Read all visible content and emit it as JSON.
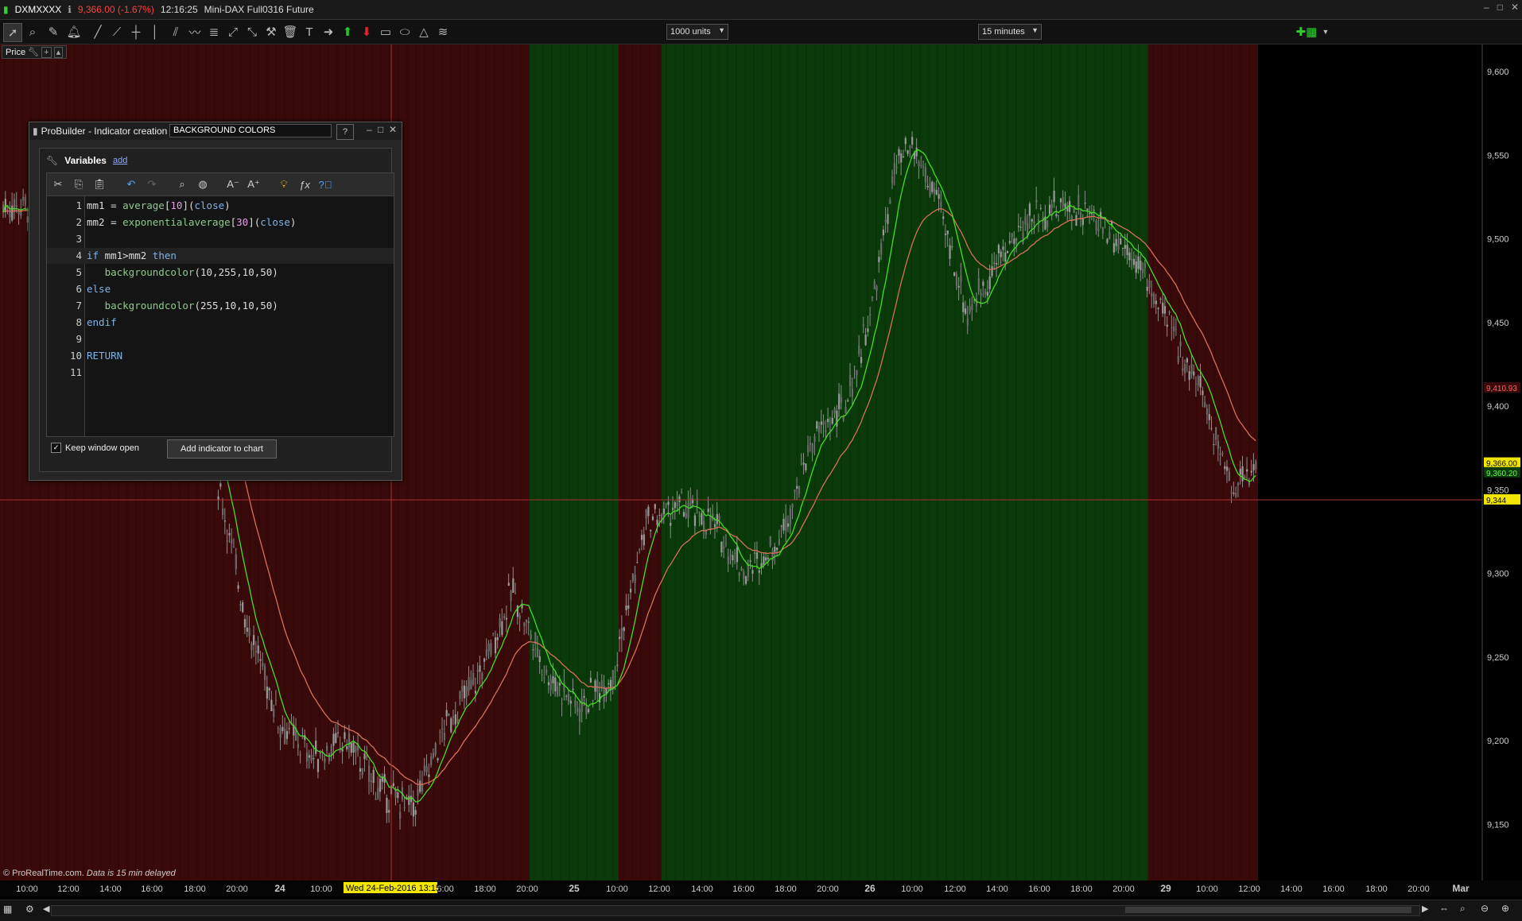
{
  "titlebar": {
    "instrument": "DXMXXXX",
    "price_change": "9,366.00 (-1.67%)",
    "time": "12:16:25",
    "name": "Mini-DAX Full0316 Future"
  },
  "toolbar": {
    "units_value": "1000 units",
    "timeframe_value": "15 minutes"
  },
  "chart": {
    "price_label": "Price",
    "y_ticks": [
      "9,600",
      "9,550",
      "9,500",
      "9,450",
      "9,400",
      "9,350",
      "9,300",
      "9,250",
      "9,200",
      "9,150"
    ],
    "x_ticks": [
      "10:00",
      "12:00",
      "14:00",
      "16:00",
      "18:00",
      "20:00",
      "24",
      "10:00",
      "16:00",
      "18:00",
      "20:00",
      "25",
      "10:00",
      "12:00",
      "14:00",
      "16:00",
      "18:00",
      "20:00",
      "26",
      "10:00",
      "12:00",
      "14:00",
      "16:00",
      "18:00",
      "20:00",
      "29",
      "10:00",
      "12:00",
      "14:00",
      "16:00",
      "18:00",
      "20:00",
      "Mar"
    ],
    "cursor_date": "Wed 24-Feb-2016 13:15",
    "labels": {
      "ema30": "9,410.93",
      "last_price": "9,366.00",
      "ma10": "9,360.20",
      "cursor_price": "9,344"
    },
    "footer_copyright": "© ProRealTime.com",
    "footer_delay": "Data is 15 min delayed",
    "colors": {
      "bullish_background": "#0a3a0a",
      "bearish_background": "#3a0a0a",
      "ma10_line": "#44dd22",
      "ema30_line": "#d8705a",
      "candles": "#8c8c8c",
      "last_price_label": "#f2e600"
    }
  },
  "probuilder": {
    "window_title": "ProBuilder - Indicator creation  -",
    "indicator_name": "BACKGROUND COLORS",
    "variables_label": "Variables",
    "add_link": "add",
    "code_lines": [
      "mm1 = average[10](close)",
      "mm2 = exponentialaverage[30](close)",
      "",
      "if mm1>mm2 then",
      "   backgroundcolor(10,255,10,50)",
      "else",
      "   backgroundcolor(255,10,10,50)",
      "endif",
      "",
      "RETURN",
      ""
    ],
    "line_numbers": [
      "1",
      "2",
      "3",
      "4",
      "5",
      "6",
      "7",
      "8",
      "9",
      "10",
      "11"
    ],
    "keep_window_open": "Keep window open",
    "add_to_chart": "Add indicator to chart"
  }
}
